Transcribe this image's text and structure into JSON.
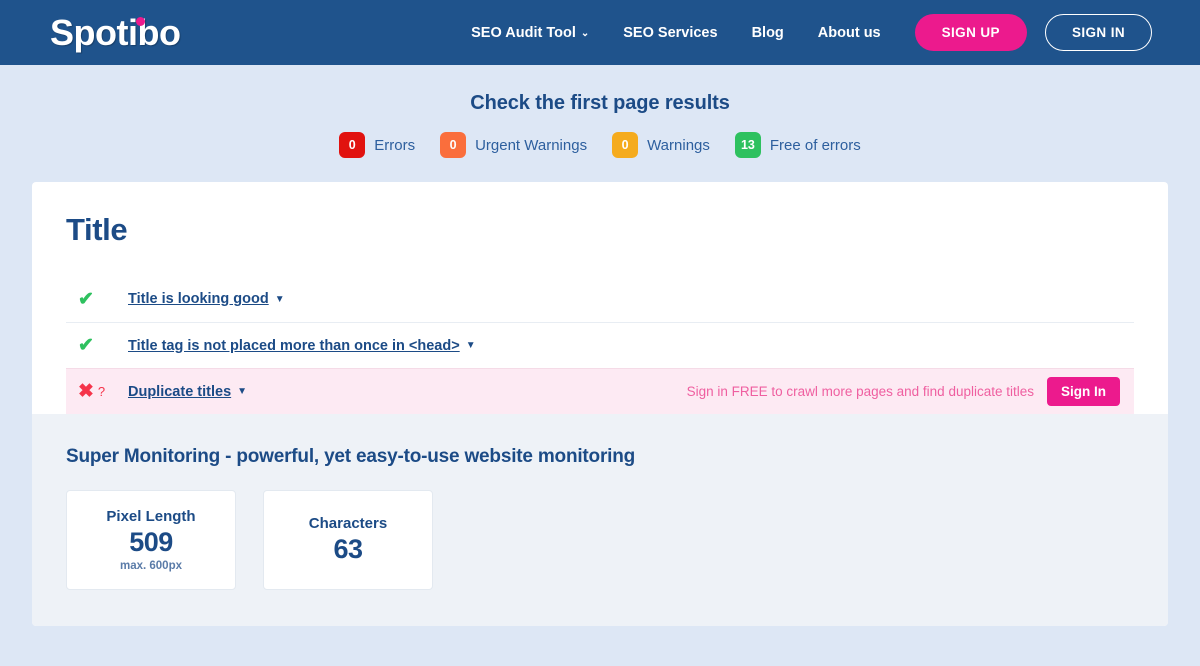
{
  "header": {
    "logo_text": "Spotibo",
    "logo_dot_color": "#ec1a8d",
    "background_color": "#1f538c",
    "nav": [
      {
        "label": "SEO Audit Tool",
        "has_caret": true,
        "caret": "⌄"
      },
      {
        "label": "SEO Services",
        "has_caret": false
      },
      {
        "label": "Blog",
        "has_caret": false
      },
      {
        "label": "About us",
        "has_caret": false
      }
    ],
    "sign_up_label": "SIGN UP",
    "sign_in_label": "SIGN IN"
  },
  "summary": {
    "title": "Check the first page results",
    "badges": [
      {
        "count": "0",
        "label": "Errors",
        "color": "#e1120f"
      },
      {
        "count": "0",
        "label": "Urgent Warnings",
        "color": "#fa6e3c"
      },
      {
        "count": "0",
        "label": "Warnings",
        "color": "#f5ab1d"
      },
      {
        "count": "13",
        "label": "Free of errors",
        "color": "#2ec15f"
      }
    ]
  },
  "report": {
    "section_title": "Title",
    "rows": [
      {
        "status": "pass",
        "status_icon": "check-icon",
        "icon_glyph": "✔",
        "label": "Title is looking good",
        "caret": "▼",
        "has_question": false,
        "promo": null,
        "button": null
      },
      {
        "status": "pass",
        "status_icon": "check-icon",
        "icon_glyph": "✔",
        "label": "Title tag is not placed more than once in <head>",
        "caret": "▼",
        "has_question": false,
        "promo": null,
        "button": null
      },
      {
        "status": "locked",
        "status_icon": "cross-icon",
        "icon_glyph": "✖",
        "question_glyph": "?",
        "label": "Duplicate titles",
        "caret": "▼",
        "has_question": true,
        "promo": "Sign in FREE to crawl more pages and find duplicate titles",
        "button": "Sign In"
      }
    ]
  },
  "monitoring": {
    "title": "Super Monitoring - powerful, yet easy-to-use website monitoring",
    "stats": [
      {
        "label": "Pixel Length",
        "value": "509",
        "sub": "max. 600px"
      },
      {
        "label": "Characters",
        "value": "63",
        "sub": ""
      }
    ]
  }
}
